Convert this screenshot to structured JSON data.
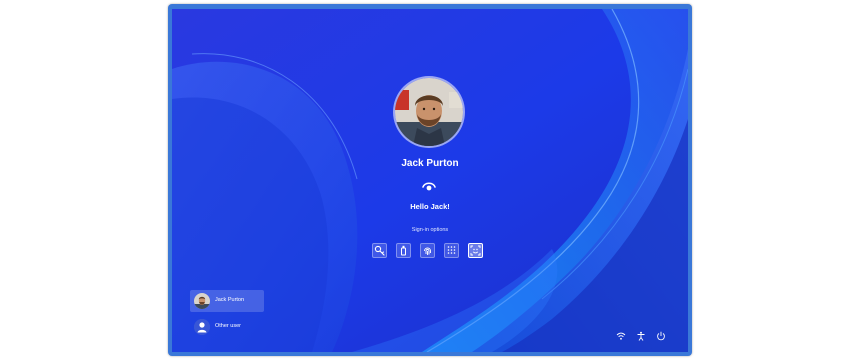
{
  "lockscreen": {
    "user_name": "Jack Purton",
    "greeting": "Hello Jack!",
    "signin_options_label": "Sign-in options"
  },
  "signin_options": [
    {
      "icon": "key-icon",
      "selected": false
    },
    {
      "icon": "security-key-icon",
      "selected": false
    },
    {
      "icon": "fingerprint-icon",
      "selected": false
    },
    {
      "icon": "pin-keypad-icon",
      "selected": false
    },
    {
      "icon": "face-smile-icon",
      "selected": true
    }
  ],
  "users": [
    {
      "label": "Jack Purton",
      "icon": "avatar",
      "selected": true
    },
    {
      "label": "Other user",
      "icon": "person-icon",
      "selected": false
    }
  ],
  "tray": {
    "icons": [
      "wifi-icon",
      "accessibility-icon",
      "power-icon"
    ]
  },
  "colors": {
    "wallpaper_base": "#1f3fe6",
    "frame_border": "#3a78d8",
    "text": "#ffffff"
  }
}
